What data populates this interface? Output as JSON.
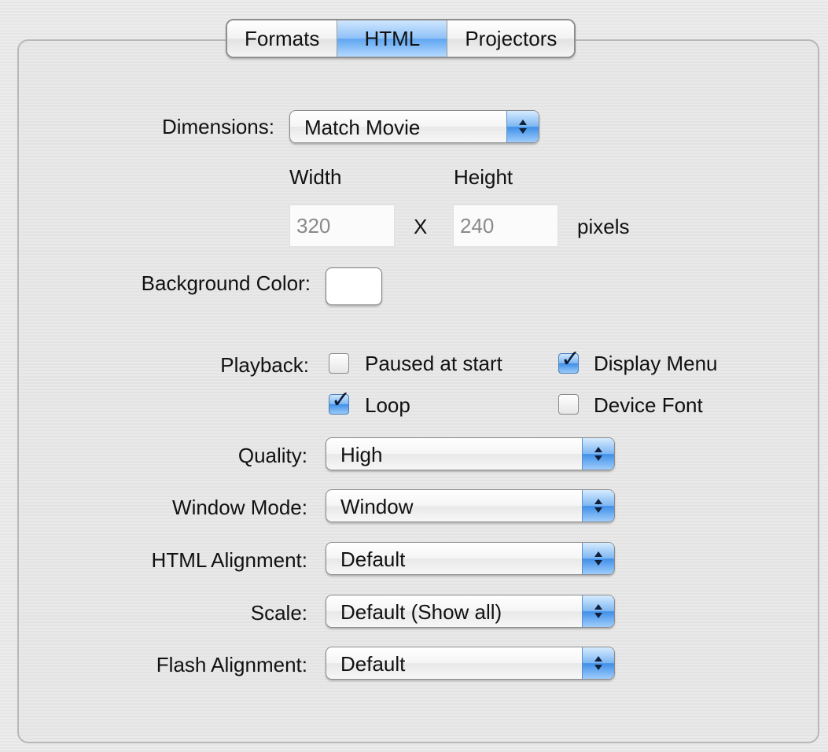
{
  "tabs": [
    {
      "label": "Formats",
      "active": false
    },
    {
      "label": "HTML",
      "active": true
    },
    {
      "label": "Projectors",
      "active": false
    }
  ],
  "dimensions": {
    "label": "Dimensions:",
    "value": "Match Movie",
    "width_label": "Width",
    "height_label": "Height",
    "width_value": "320",
    "x_label": "X",
    "height_value": "240",
    "unit": "pixels"
  },
  "background_color": {
    "label": "Background Color:",
    "color": "#ffffff"
  },
  "playback": {
    "label": "Playback:",
    "options": [
      {
        "label": "Paused at start",
        "checked": false
      },
      {
        "label": "Display Menu",
        "checked": true
      },
      {
        "label": "Loop",
        "checked": true
      },
      {
        "label": "Device Font",
        "checked": false
      }
    ]
  },
  "popups": [
    {
      "label": "Quality:",
      "value": "High"
    },
    {
      "label": "Window Mode:",
      "value": "Window"
    },
    {
      "label": "HTML Alignment:",
      "value": "Default"
    },
    {
      "label": "Scale:",
      "value": "Default (Show all)"
    },
    {
      "label": "Flash Alignment:",
      "value": "Default"
    }
  ],
  "colors": {
    "accent_blue": "#3f8fe8"
  },
  "icons": {
    "popup_arrow": "up-down-arrows-icon",
    "checkmark": "checkmark-icon"
  }
}
